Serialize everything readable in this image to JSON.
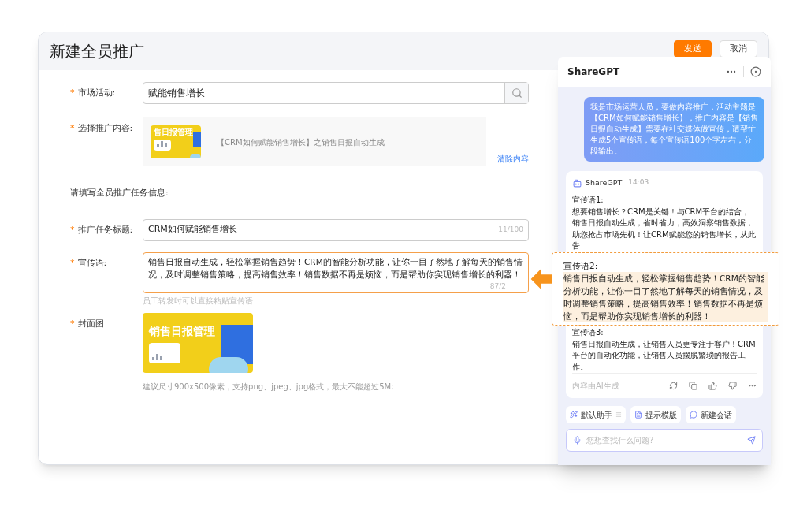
{
  "page": {
    "title": "新建全员推广",
    "buttons": [
      {
        "label": "发送",
        "kind": "primary"
      },
      {
        "label": "取消",
        "kind": "default"
      }
    ]
  },
  "form": {
    "required_mark": "*",
    "market_activity": {
      "label": "市场活动:",
      "required": true,
      "value": "赋能销售增长"
    },
    "content": {
      "label": "选择推广内容:",
      "required": true,
      "thumbnail_text": "售日报管理",
      "title": "【CRM如何赋能销售增长】之销售日报自动生成",
      "clear_link": "清除内容"
    },
    "section_heading": "请填写全员推广任务信息:",
    "task_title": {
      "label": "推广任务标题:",
      "required": true,
      "value": "CRM如何赋能销售增长",
      "counter": "11/100"
    },
    "slogan": {
      "label": "宣传语:",
      "required": true,
      "focused": true,
      "value": "销售日报自动生成，轻松掌握销售趋势！CRM的智能分析功能，让你一目了然地了解每天的销售情况，及时调整销售策略，提高销售效率！销售数据不再是烦恼，而是帮助你实现销售增长的利器！",
      "counter": "87/2",
      "hint": "员工转发时可以直接粘贴宣传语"
    },
    "cover": {
      "label": "封面图",
      "required": true,
      "image_title": "销售日报管理",
      "hint": "建议尺寸900x500像素，支持png、jpeg、jpg格式，最大不能超过5M;"
    }
  },
  "assistant": {
    "title": "ShareGPT",
    "user_message": "我是市场运营人员，要做内容推广，活动主题是【CRM如何赋能销售增长】，推广内容是【销售日报自动生成】需要在社交媒体做宣传，请帮忙生成5个宣传语，每个宣传语100个字左右，分段输出。",
    "reply": {
      "sender": "ShareGPT",
      "time": "14:03",
      "items": [
        {
          "heading": "宣传语1:",
          "body": "想要销售增长？CRM是关键！与CRM平台的结合，销售日报自动生成，省时省力，高效洞察销售数据，助您抢占市场先机！让CRM赋能您的销售增长，从此告"
        },
        {
          "heading": "宣传语3:",
          "body": "销售日报自动生成，让销售人员更专注于客户！CRM平台的自动化功能，让销售人员摆脱繁琐的报告工作。"
        }
      ],
      "disclaimer": "内容由AI生成"
    },
    "tools": [
      "默认助手",
      "提示模版",
      "新建会话"
    ],
    "input": {
      "placeholder": "您想查找什么问题?"
    }
  },
  "callout": {
    "heading": "宣传语2:",
    "body": "销售日报自动生成，轻松掌握销售趋势！CRM的智能分析功能，让你一目了然地了解每天的销售情况，及时调整销售策略，提高销售效率！销售数据不再是烦恼，而是帮助你实现销售增长的利器！"
  }
}
